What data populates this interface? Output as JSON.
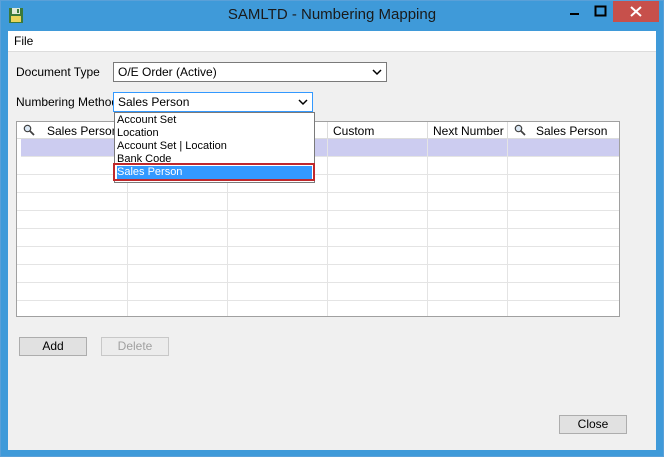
{
  "window": {
    "title": "SAMLTD - Numbering Mapping",
    "min_glyph": "—",
    "max_glyph": "□",
    "close_glyph": "✕"
  },
  "menu": {
    "file_label": "File"
  },
  "document_type": {
    "label": "Document Type",
    "value": "O/E Order (Active)"
  },
  "numbering_method": {
    "label": "Numbering Method",
    "value": "Sales Person",
    "options": [
      "Account Set",
      "Location",
      "Account Set | Location",
      "Bank Code",
      "Sales Person"
    ],
    "selected_index": 4
  },
  "grid": {
    "columns": [
      {
        "label": "Sales Person",
        "icon": "search-icon"
      },
      {
        "label": "",
        "icon": ""
      },
      {
        "label": "",
        "icon": ""
      },
      {
        "label": "Custom",
        "icon": ""
      },
      {
        "label": "Next Number",
        "icon": ""
      },
      {
        "label": "Sales Person",
        "icon": "search-icon"
      }
    ]
  },
  "buttons": {
    "add": "Add",
    "delete": "Delete",
    "close": "Close"
  },
  "colors": {
    "title_bar": "#3f9ad9",
    "selection": "#3399ff",
    "highlight_box": "#c0282c",
    "grid_row_selected": "#ccccf0"
  }
}
